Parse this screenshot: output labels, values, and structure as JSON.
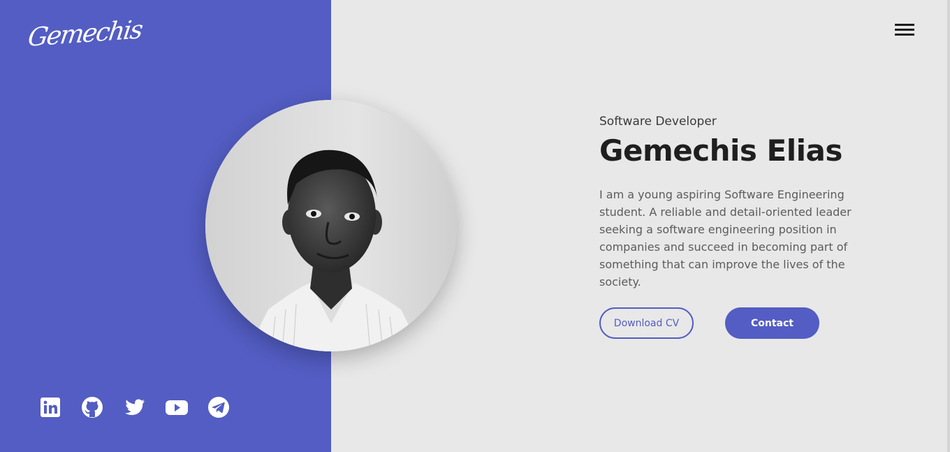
{
  "brand": {
    "logo_text": "Gemechis"
  },
  "hero": {
    "subtitle": "Software Developer",
    "name": "Gemechis Elias",
    "bio": "I am a young aspiring Software Engineering student. A reliable and detail-oriented leader seeking a software engineering position in companies and succeed in becoming part of something that can improve the lives of the society.",
    "download_cv_label": "Download CV",
    "contact_label": "Contact"
  },
  "socials": [
    {
      "icon": "linkedin-icon"
    },
    {
      "icon": "github-icon"
    },
    {
      "icon": "twitter-icon"
    },
    {
      "icon": "youtube-icon"
    },
    {
      "icon": "telegram-icon"
    }
  ],
  "nav": {
    "menu_icon": "hamburger-menu-icon"
  },
  "colors": {
    "accent": "#535dc3",
    "background": "#e8e8e8",
    "text_dark": "#1f1f1f",
    "text_muted": "#5c5c5c"
  }
}
